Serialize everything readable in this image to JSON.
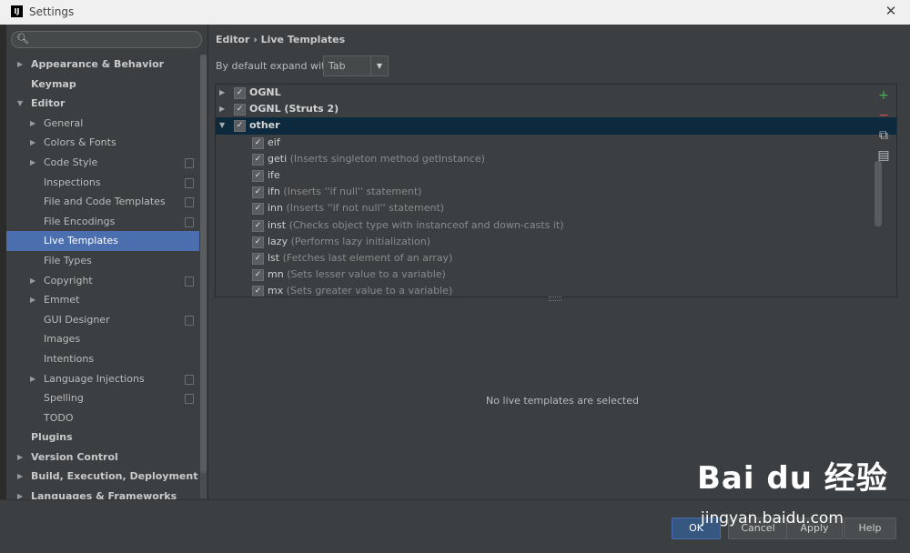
{
  "window": {
    "title": "Settings",
    "app_icon": "IJ"
  },
  "search": {
    "placeholder": ""
  },
  "tree": [
    {
      "label": "Appearance & Behavior",
      "level": 0,
      "arrow": "▶",
      "bold": true,
      "copy": false
    },
    {
      "label": "Keymap",
      "level": 0,
      "arrow": "",
      "bold": true,
      "copy": false
    },
    {
      "label": "Editor",
      "level": 0,
      "arrow": "▼",
      "bold": true,
      "copy": false
    },
    {
      "label": "General",
      "level": 1,
      "arrow": "▶",
      "bold": false,
      "copy": false
    },
    {
      "label": "Colors & Fonts",
      "level": 1,
      "arrow": "▶",
      "bold": false,
      "copy": false
    },
    {
      "label": "Code Style",
      "level": 1,
      "arrow": "▶",
      "bold": false,
      "copy": true
    },
    {
      "label": "Inspections",
      "level": 1,
      "arrow": "",
      "bold": false,
      "copy": true
    },
    {
      "label": "File and Code Templates",
      "level": 1,
      "arrow": "",
      "bold": false,
      "copy": true
    },
    {
      "label": "File Encodings",
      "level": 1,
      "arrow": "",
      "bold": false,
      "copy": true
    },
    {
      "label": "Live Templates",
      "level": 1,
      "arrow": "",
      "bold": false,
      "copy": false,
      "selected": true
    },
    {
      "label": "File Types",
      "level": 1,
      "arrow": "",
      "bold": false,
      "copy": false
    },
    {
      "label": "Copyright",
      "level": 1,
      "arrow": "▶",
      "bold": false,
      "copy": true
    },
    {
      "label": "Emmet",
      "level": 1,
      "arrow": "▶",
      "bold": false,
      "copy": false
    },
    {
      "label": "GUI Designer",
      "level": 1,
      "arrow": "",
      "bold": false,
      "copy": true
    },
    {
      "label": "Images",
      "level": 1,
      "arrow": "",
      "bold": false,
      "copy": false
    },
    {
      "label": "Intentions",
      "level": 1,
      "arrow": "",
      "bold": false,
      "copy": false
    },
    {
      "label": "Language Injections",
      "level": 1,
      "arrow": "▶",
      "bold": false,
      "copy": true
    },
    {
      "label": "Spelling",
      "level": 1,
      "arrow": "",
      "bold": false,
      "copy": true
    },
    {
      "label": "TODO",
      "level": 1,
      "arrow": "",
      "bold": false,
      "copy": false
    },
    {
      "label": "Plugins",
      "level": 0,
      "arrow": "",
      "bold": true,
      "copy": false
    },
    {
      "label": "Version Control",
      "level": 0,
      "arrow": "▶",
      "bold": true,
      "copy": false
    },
    {
      "label": "Build, Execution, Deployment",
      "level": 0,
      "arrow": "▶",
      "bold": true,
      "copy": false
    },
    {
      "label": "Languages & Frameworks",
      "level": 0,
      "arrow": "▶",
      "bold": true,
      "copy": false
    }
  ],
  "breadcrumb": "Editor › Live Templates",
  "expand": {
    "label": "By default expand with",
    "value": "Tab"
  },
  "templates": [
    {
      "name": "OGNL",
      "desc": "",
      "group": true,
      "arrow": "▶",
      "checked": true
    },
    {
      "name": "OGNL (Struts 2)",
      "desc": "",
      "group": true,
      "arrow": "▶",
      "checked": true
    },
    {
      "name": "other",
      "desc": "",
      "group": true,
      "arrow": "▼",
      "checked": true,
      "selected": true
    },
    {
      "name": "eif",
      "desc": "",
      "group": false,
      "checked": true
    },
    {
      "name": "geti",
      "desc": "(Inserts singleton method getInstance)",
      "group": false,
      "checked": true
    },
    {
      "name": "ife",
      "desc": "",
      "group": false,
      "checked": true
    },
    {
      "name": "ifn",
      "desc": "(Inserts ''if null'' statement)",
      "group": false,
      "checked": true
    },
    {
      "name": "inn",
      "desc": "(Inserts ''if not null'' statement)",
      "group": false,
      "checked": true
    },
    {
      "name": "inst",
      "desc": "(Checks object type with instanceof and down-casts it)",
      "group": false,
      "checked": true
    },
    {
      "name": "lazy",
      "desc": "(Performs lazy initialization)",
      "group": false,
      "checked": true
    },
    {
      "name": "lst",
      "desc": "(Fetches last element of an array)",
      "group": false,
      "checked": true
    },
    {
      "name": "mn",
      "desc": "(Sets lesser value to a variable)",
      "group": false,
      "checked": true
    },
    {
      "name": "mx",
      "desc": "(Sets greater value to a variable)",
      "group": false,
      "checked": true
    }
  ],
  "tools": [
    {
      "name": "add-icon",
      "glyph": "+",
      "color": "#4caf50"
    },
    {
      "name": "remove-icon",
      "glyph": "−",
      "color": "#d9534f"
    },
    {
      "name": "copy-icon",
      "glyph": "⧉",
      "color": "#bbbbbb"
    },
    {
      "name": "edit-icon",
      "glyph": "▤",
      "color": "#bbbbbb"
    }
  ],
  "empty_message": "No live templates are selected",
  "buttons": {
    "ok": "OK",
    "cancel": "Cancel",
    "apply": "Apply",
    "help": "Help"
  },
  "watermark": {
    "logo": "Bai du 经验",
    "url": "jingyan.baidu.com"
  },
  "colors": {
    "selection": "#4b6eaf",
    "panel": "#3c3f41",
    "row_selected": "#0d293e"
  }
}
